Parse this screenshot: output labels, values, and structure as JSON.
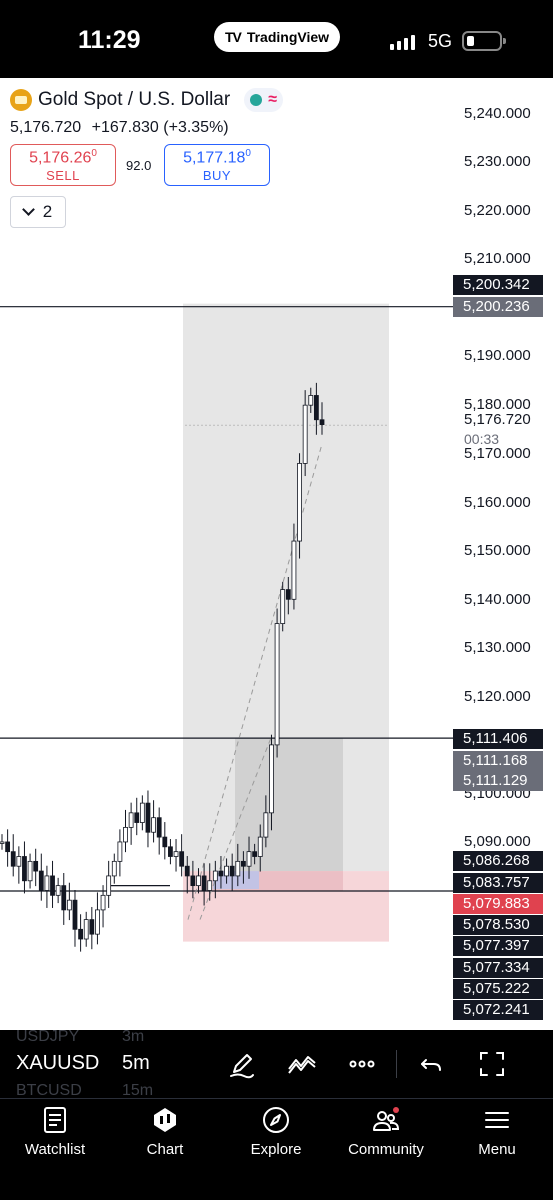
{
  "status_bar": {
    "time": "11:29",
    "app_pill": "TradingView",
    "network": "5G"
  },
  "symbol": {
    "name": "Gold Spot / U.S. Dollar",
    "last": "5,176.720",
    "change": "+167.830 (+3.35%)",
    "badge_icons": [
      "market-open-dot-icon",
      "wave-icon"
    ]
  },
  "trade": {
    "sell_price": "5,176.26",
    "sell_price_sup": "0",
    "sell_label": "SELL",
    "spread": "92.0",
    "buy_price": "5,177.18",
    "buy_price_sup": "0",
    "buy_label": "BUY"
  },
  "collapse": {
    "count": "2"
  },
  "price_axis": {
    "labels": [
      "5,240.000",
      "5,230.000",
      "5,220.000",
      "5,210.000",
      "5,190.000",
      "5,180.000",
      "5,170.000",
      "5,160.000",
      "5,150.000",
      "5,140.000",
      "5,130.000",
      "5,120.000",
      "5,100.000",
      "5,090.000"
    ],
    "countdown": "00:33"
  },
  "price_tags": [
    {
      "value": "5,200.342",
      "style": "black"
    },
    {
      "value": "5,200.236",
      "style": "gray"
    },
    {
      "value": "5,176.720",
      "style": "plain"
    },
    {
      "value": "5,111.406",
      "style": "black"
    },
    {
      "value": "5,111.168",
      "style": "gray"
    },
    {
      "value": "5,111.129",
      "style": "gray"
    },
    {
      "value": "5,086.268",
      "style": "black"
    },
    {
      "value": "5,083.757",
      "style": "black"
    },
    {
      "value": "5,079.883",
      "style": "red"
    },
    {
      "value": "5,078.530",
      "style": "black"
    },
    {
      "value": "5,077.397",
      "style": "black"
    },
    {
      "value": "5,077.334",
      "style": "black"
    },
    {
      "value": "5,075.222",
      "style": "black"
    },
    {
      "value": "5,072.241",
      "style": "black"
    }
  ],
  "chart_data": {
    "type": "candlestick",
    "symbol": "XAUUSD",
    "interval": "5m",
    "ylim": [
      5065,
      5245
    ],
    "horizontal_lines": [
      5200.3,
      5111.4,
      5079.9
    ],
    "position_tool": {
      "entry": 5084,
      "target": 5200.3,
      "stop": 5074
    },
    "close_series": [
      5090,
      5088,
      5085,
      5087,
      5082,
      5086,
      5084,
      5080,
      5083,
      5079,
      5081,
      5076,
      5078,
      5072,
      5070,
      5074,
      5071,
      5076,
      5079,
      5083,
      5086,
      5090,
      5093,
      5096,
      5094,
      5098,
      5092,
      5095,
      5091,
      5089,
      5087,
      5088,
      5085,
      5083,
      5081,
      5083,
      5080,
      5082,
      5084,
      5083,
      5085,
      5083,
      5086,
      5085,
      5088,
      5087,
      5091,
      5096,
      5110,
      5135,
      5142,
      5140,
      5152,
      5168,
      5180,
      5182,
      5177,
      5176
    ]
  },
  "toolbar": {
    "symbol": "XAUUSD",
    "interval": "5m",
    "ghost_rows": [
      {
        "symbol": "USDJPY",
        "interval": "3m"
      },
      {
        "symbol": "BTCUSD",
        "interval": "15m"
      }
    ],
    "tools": [
      "pencil-icon",
      "trend-icon",
      "more-icon",
      "undo-icon",
      "fullscreen-icon"
    ]
  },
  "tabs": [
    {
      "label": "Watchlist",
      "icon": "watchlist-icon"
    },
    {
      "label": "Chart",
      "icon": "chart-icon"
    },
    {
      "label": "Explore",
      "icon": "compass-icon"
    },
    {
      "label": "Community",
      "icon": "community-icon"
    },
    {
      "label": "Menu",
      "icon": "menu-icon"
    }
  ],
  "colors": {
    "sell": "#e0424f",
    "buy": "#2962ff",
    "gold": "#e8a317",
    "stop_zone": "#f6d6d9",
    "target_zone": "#d6d6d6"
  }
}
